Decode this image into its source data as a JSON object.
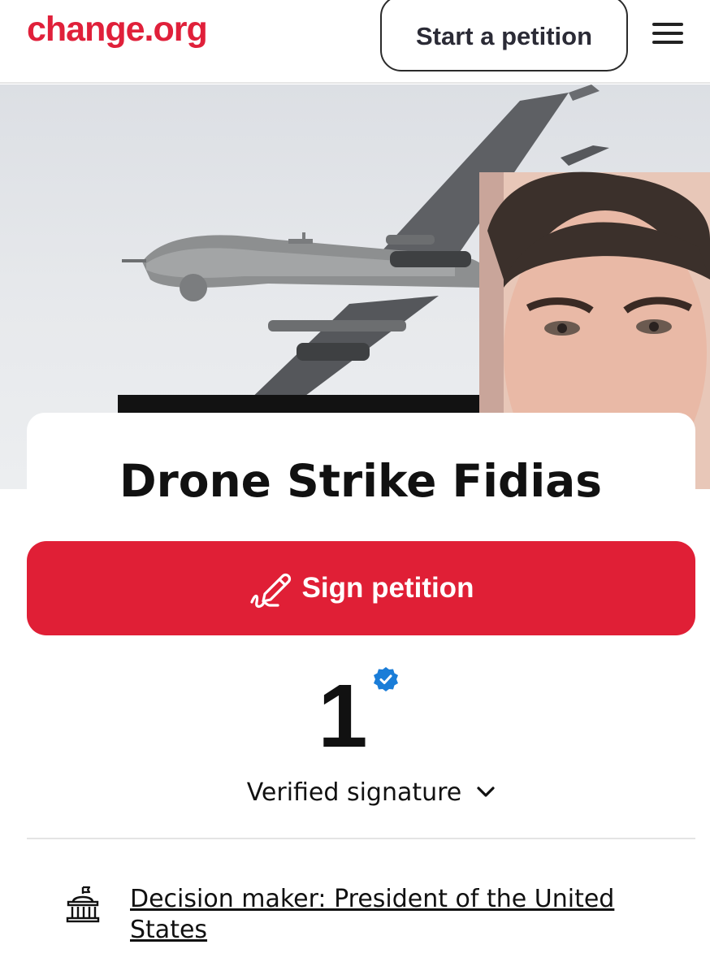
{
  "header": {
    "logo": "change.org",
    "start_petition_label": "Start a petition",
    "menu_icon": "hamburger-menu-icon"
  },
  "hero": {
    "image_description_icon": "drone-photo"
  },
  "petition": {
    "title": "Drone Strike Fidias",
    "sign_label": "Sign petition",
    "sign_icon": "pen-signature-icon",
    "signature_count": "1",
    "verified_label": "Verified signature",
    "decision_maker": "Decision maker: President of the United States"
  },
  "colors": {
    "brand": "#e0203a",
    "verified_blue": "#1a7dd8"
  }
}
